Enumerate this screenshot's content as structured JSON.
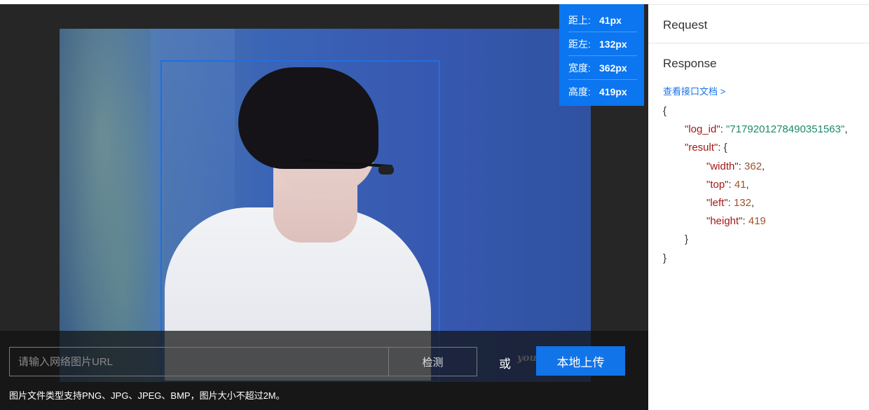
{
  "detection_info": {
    "top_label": "距上:",
    "top_value": "41px",
    "left_label": "距左:",
    "left_value": "132px",
    "width_label": "宽度:",
    "width_value": "362px",
    "height_label": "高度:",
    "height_value": "419px"
  },
  "upload": {
    "url_placeholder": "请输入网络图片URL",
    "detect_label": "检测",
    "or_label": "或",
    "local_upload_label": "本地上传",
    "hint": "图片文件类型支持PNG、JPG、JPEG、BMP，图片大小不超过2M。"
  },
  "image_overlay_text": "you",
  "sidebar": {
    "request_title": "Request",
    "response_title": "Response",
    "doc_link": "查看接口文档 >"
  },
  "response": {
    "open_brace": "{",
    "log_id_key": "\"log_id\"",
    "log_id_value": "\"7179201278490351563\"",
    "result_key": "\"result\"",
    "width_key": "\"width\"",
    "width_value": "362",
    "top_key": "\"top\"",
    "top_value": "41",
    "left_key": "\"left\"",
    "left_value": "132",
    "height_key": "\"height\"",
    "height_value": "419",
    "close_brace": "}"
  },
  "colors": {
    "accent": "#1174e8",
    "info_box": "#0b76f0",
    "json_key": "#a61717",
    "json_string": "#1b8a6b",
    "json_number": "#a0522d"
  }
}
